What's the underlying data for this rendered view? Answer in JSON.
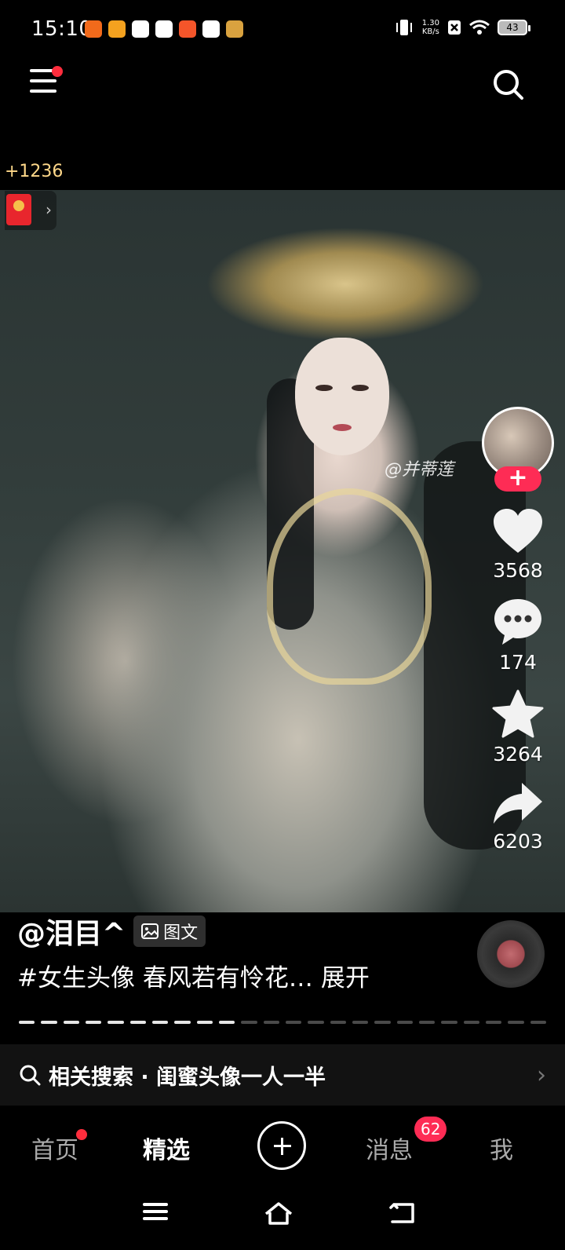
{
  "status_bar": {
    "time": "15:10",
    "net_speed_value": "1.30",
    "net_speed_unit": "KB/s",
    "battery": "43",
    "app_icons": [
      "app-icon-1",
      "app-icon-2",
      "app-icon-3",
      "app-icon-4",
      "app-icon-5",
      "tiktok-icon",
      "app-icon-7"
    ],
    "app_icon_colors": [
      "#f26a1b",
      "#f4a21f",
      "#ffffff",
      "#ffffff",
      "#f4552a",
      "#ffffff",
      "#d9a23f"
    ]
  },
  "header": {
    "coin_reward": "+1236"
  },
  "video": {
    "watermark": "@并蒂莲"
  },
  "actions": {
    "like_count": "3568",
    "comment_count": "174",
    "favorite_count": "3264",
    "share_count": "6203",
    "follow_symbol": "+"
  },
  "post": {
    "author": "@泪目^",
    "type_label": "图文",
    "caption": "#女生头像 春风若有怜花…",
    "expand_label": "展开",
    "progress_total": 24,
    "progress_done": 10
  },
  "related_search": {
    "label": "相关搜索 · 闺蜜头像一人一半"
  },
  "tabbar": {
    "home": "首页",
    "featured": "精选",
    "messages": "消息",
    "messages_badge": "62",
    "me": "我"
  },
  "colors": {
    "accent": "#fe2c55",
    "notification_dot": "#ff2d3d",
    "coin": "#ffd88a"
  }
}
